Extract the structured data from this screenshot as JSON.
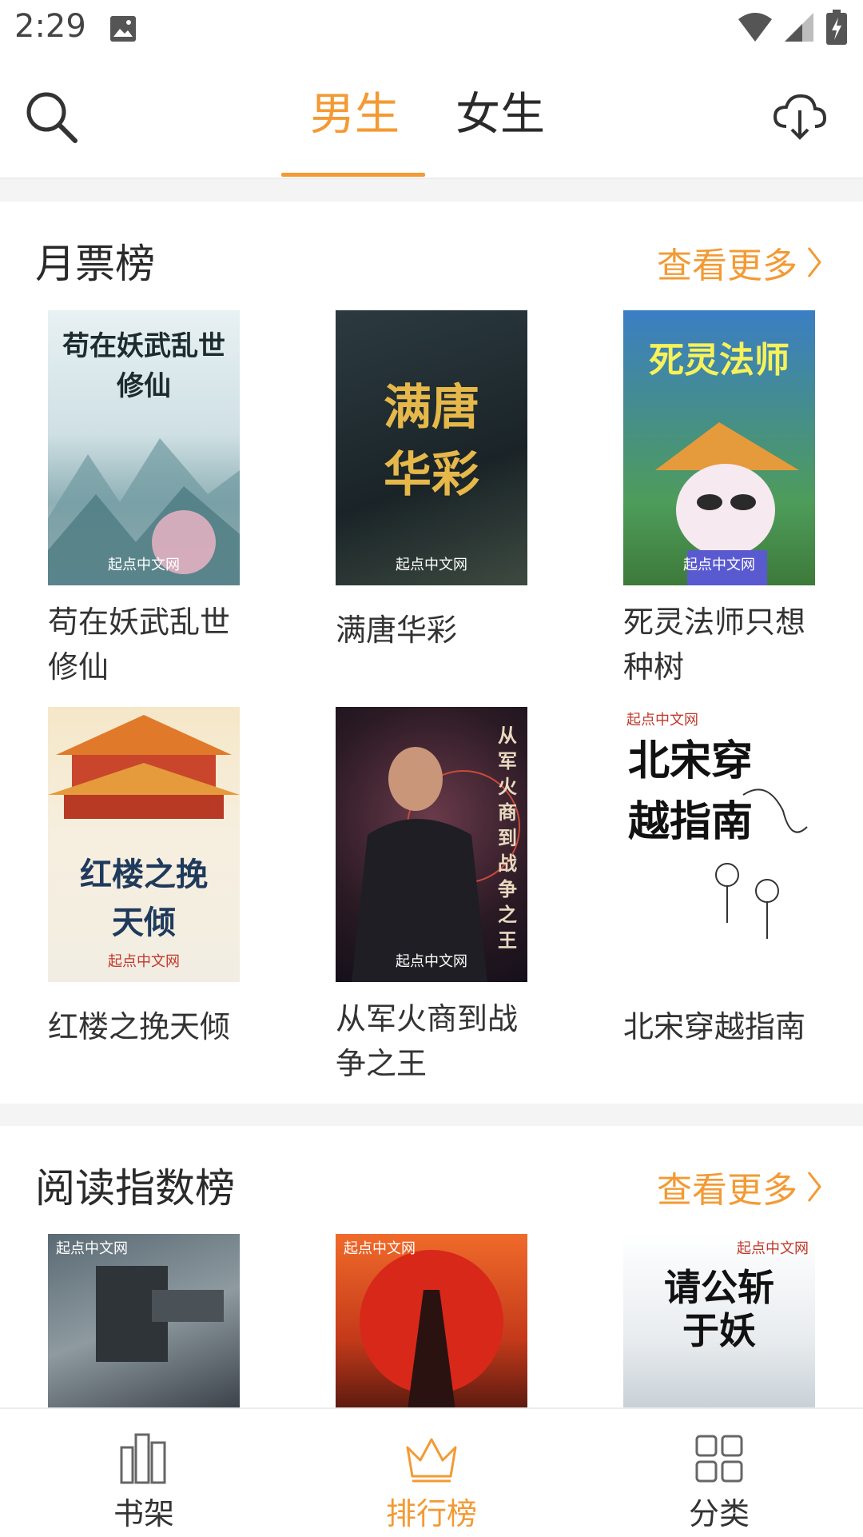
{
  "status_bar": {
    "time": "2:29"
  },
  "header": {
    "tabs": [
      {
        "label": "男生",
        "active": true
      },
      {
        "label": "女生",
        "active": false
      }
    ]
  },
  "sections": [
    {
      "title": "月票榜",
      "more_label": "查看更多",
      "books": [
        {
          "title": "苟在妖武乱世修仙",
          "cover_text": "苟在妖武乱世修仙",
          "cover_brand": "起点中文网"
        },
        {
          "title": "满唐华彩",
          "cover_text": "满唐华彩",
          "cover_brand": "起点中文网"
        },
        {
          "title": "死灵法师只想种树",
          "cover_text": "死灵法师",
          "cover_brand": "起点中文网"
        },
        {
          "title": "红楼之挽天倾",
          "cover_text": "红楼之挽天倾",
          "cover_brand": "起点中文网"
        },
        {
          "title": "从军火商到战争之王",
          "cover_text": "从军火商到战争之王",
          "cover_brand": "起点中文网"
        },
        {
          "title": "北宋穿越指南",
          "cover_text": "北宋穿越指南",
          "cover_brand": "起点中文网"
        }
      ]
    },
    {
      "title": "阅读指数榜",
      "more_label": "查看更多",
      "books": [
        {
          "title": "",
          "cover_text": "",
          "cover_brand": "起点中文网"
        },
        {
          "title": "",
          "cover_text": "",
          "cover_brand": "起点中文网"
        },
        {
          "title": "",
          "cover_text": "请公斩于妖",
          "cover_brand": "起点中文网"
        }
      ]
    }
  ],
  "bottom_nav": [
    {
      "label": "书架",
      "icon": "bookshelf-icon",
      "active": false
    },
    {
      "label": "排行榜",
      "icon": "crown-icon",
      "active": true
    },
    {
      "label": "分类",
      "icon": "grid-icon",
      "active": false
    }
  ],
  "colors": {
    "accent": "#f39a34",
    "text": "#2a2a2a",
    "divider": "#f4f4f4"
  }
}
